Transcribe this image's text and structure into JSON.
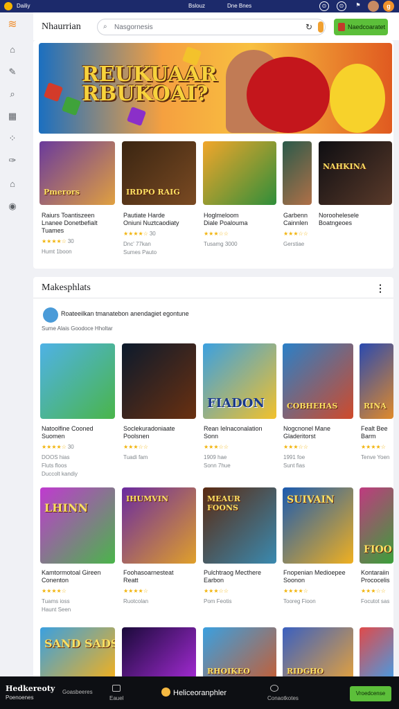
{
  "topbar": {
    "app_name": "Dailiy",
    "center_left": "Bslouz",
    "center_right": "Dne Bnes",
    "badge": "g"
  },
  "sidebar": {
    "items": [
      {
        "icon": "stack-logo-icon"
      },
      {
        "icon": "home-icon"
      },
      {
        "icon": "edit-icon"
      },
      {
        "icon": "search-icon"
      },
      {
        "icon": "grid-icon"
      },
      {
        "icon": "dots-icon"
      },
      {
        "icon": "brush-icon"
      },
      {
        "icon": "store-icon"
      },
      {
        "icon": "help-icon"
      }
    ]
  },
  "header": {
    "title": "Nhaurrian",
    "search_placeholder": "Nasgornesis",
    "cta_label": "Naedcoaratet"
  },
  "banner": {
    "headline_line1": "REUKUAAR",
    "headline_line2": "RBUKOAI?"
  },
  "featured": [
    {
      "logo": "Pmerors",
      "title": "Raiurs Toantiszeen",
      "title2": "Lnanee Donetbefialt",
      "title3": "Tuames",
      "rating": "★★★★☆",
      "score": "30",
      "sub": "Humt 1boon"
    },
    {
      "logo": "IRDPO RAIG",
      "title": "Pautiate Harde",
      "title2": "Oniuni Nuztcaodiaty",
      "title3": "",
      "rating": "★★★★☆",
      "score": "30",
      "sub": "Dnc' 77kan",
      "sub2": "Sumes Pauto"
    },
    {
      "logo": "",
      "title": "Hoglmeloom",
      "title2": "Diale Poalouma",
      "title3": "",
      "rating": "★★★☆☆",
      "score": "",
      "sub": "Tusamg 3000"
    },
    {
      "logo": "",
      "title": "Garbenn",
      "title2": "Cainnlen",
      "title3": "",
      "rating": "★★★☆☆",
      "score": "",
      "sub": "Gerstiae"
    },
    {
      "logo": "NAHKINA",
      "title": "Noroohelesele",
      "title2": "Boatngeoes",
      "title3": "",
      "rating": "",
      "score": "",
      "sub": ""
    }
  ],
  "section": {
    "title": "Makesphlats",
    "more": "⋮",
    "promo_line": "Roateeilkan tmanatebon  anendagiet egontune",
    "promo_sub": "Sume Alais Goodoce Hholtar"
  },
  "row1": [
    {
      "logo": "",
      "title": "Natoolfine Cooned",
      "title2": "Suomen",
      "rating": "★★★★☆",
      "score": "30",
      "sub": "DOOS hias",
      "sub2": "Fluts floos",
      "sub3": "Duccolt kandiy"
    },
    {
      "logo": "",
      "title": "Soclekuradoniaate",
      "title2": "Poolsnen",
      "rating": "★★★☆☆",
      "score": "",
      "sub": "Tuadi fam"
    },
    {
      "logo": "FIADON",
      "title": "Rean Ielnaconalation",
      "title2": "Sonn",
      "rating": "★★★☆☆",
      "score": "",
      "sub": "1909 hae",
      "sub2": "Sonn 7hue"
    },
    {
      "logo": "COBHEHAS",
      "title": "Nogcnonel Mane",
      "title2": "Gladeritorst",
      "rating": "★★★☆☆",
      "score": "",
      "sub": "1991 foe",
      "sub2": "Sunt fias"
    },
    {
      "logo": "RINA",
      "title": "Fealt Bee",
      "title2": "Barm",
      "rating": "★★★★☆",
      "score": "",
      "sub": "Tenve Yoen"
    }
  ],
  "row2": [
    {
      "logo": "LHINN",
      "title": "Kamtormotoal Gireen",
      "title2": "Conenton",
      "rating": "★★★★☆",
      "score": "",
      "sub": "Tuams ioss",
      "sub2": "Haunt Seen"
    },
    {
      "logo": "IHUMVIN",
      "title": "Foohasoarnesteat",
      "title2": "Reatt",
      "rating": "★★★★☆",
      "score": "",
      "sub": "Ruotcolan"
    },
    {
      "logo": "MEAUR FOONS",
      "title": "Pulchtraog Mecthere",
      "title2": "Earbon",
      "rating": "★★★☆☆",
      "score": "",
      "sub": "Pom Feotis"
    },
    {
      "logo": "SUIVAIN",
      "title": "Fnopenian Medioepee",
      "title2": "Soonon",
      "rating": "★★★★☆",
      "score": "",
      "sub": "Tooreg Fioon"
    },
    {
      "logo": "FIOO",
      "title": "Kontaraiin",
      "title2": "Prococelis",
      "rating": "★★★☆☆",
      "score": "",
      "sub": "Focutot sas"
    }
  ],
  "row3": [
    {
      "logo": "SAND SADS"
    },
    {
      "logo": ""
    },
    {
      "logo": "RHOIKEO"
    },
    {
      "logo": "RIDGHO"
    },
    {
      "logo": ""
    }
  ],
  "bottombar": {
    "brand": "Hedkereoty",
    "brand2": "Poenoenes",
    "link1": "Goasbeeres",
    "link2": "Eauel",
    "center": "Heliceoranphler",
    "link3": "Conaotkotes",
    "button": "Vroedcense"
  },
  "colors": {
    "accent_green": "#5cbf3a",
    "topbar_navy": "#1c2a6b",
    "star_gold": "#f2b40d"
  }
}
